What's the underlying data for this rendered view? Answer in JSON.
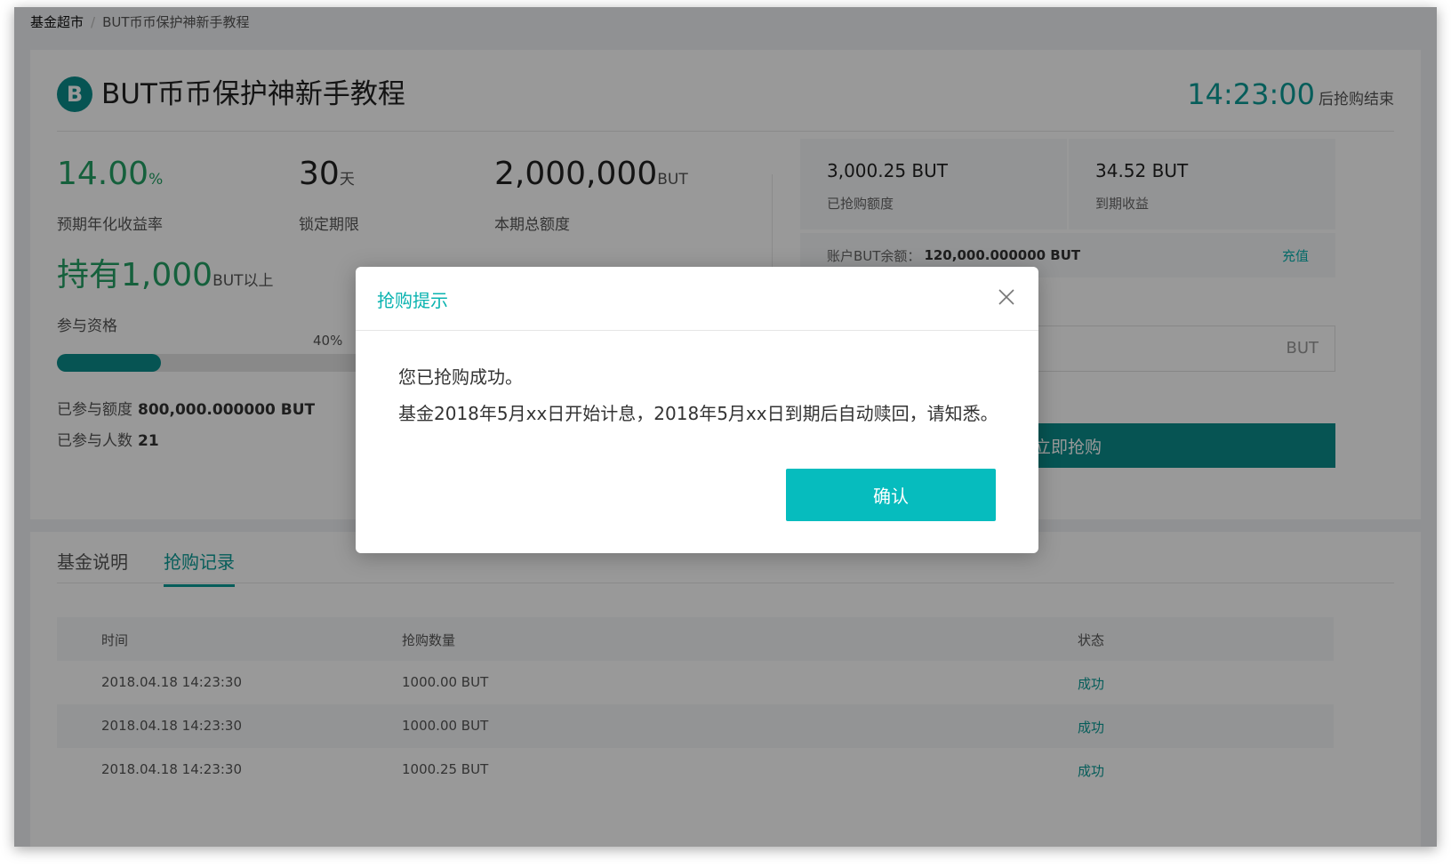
{
  "breadcrumb": {
    "root": "基金超市",
    "separator": "/",
    "current": "BUT币币保护神新手教程"
  },
  "fund": {
    "icon": "bitcoin-b-icon",
    "logo_glyph": "B",
    "title": "BUT币币保护神新手教程",
    "countdown_time": "14:23:00",
    "countdown_suffix": "后抢购结束"
  },
  "stats": {
    "rate_value": "14.00",
    "rate_unit": "%",
    "rate_label": "预期年化收益率",
    "lock_value": "30",
    "lock_unit": "天",
    "lock_label": "锁定期限",
    "total_value": "2,000,000",
    "total_unit": "BUT",
    "total_label": "本期总额度",
    "hold_value": "持有1,000",
    "hold_unit": "BUT以上",
    "hold_label": "参与资格"
  },
  "progress": {
    "percent_text": "40%",
    "value": 0.4
  },
  "participation": {
    "amount_label": "已参与额度",
    "amount_value": "800,000.000000 BUT",
    "count_label": "已参与人数",
    "count_value": "21"
  },
  "purchase": {
    "bought_value": "3,000.25 BUT",
    "bought_label": "已抢购额度",
    "income_value": "34.52 BUT",
    "income_label": "到期收益",
    "balance_label": "账户BUT余额：",
    "balance_value": "120,000.000000 BUT",
    "recharge_label": "充值",
    "input_unit": "BUT",
    "buy_button": "立即抢购"
  },
  "tabs": [
    {
      "label": "基金说明",
      "active": false
    },
    {
      "label": "抢购记录",
      "active": true
    }
  ],
  "table": {
    "headers": [
      "时间",
      "抢购数量",
      "状态"
    ],
    "rows": [
      [
        "2018.04.18 14:23:30",
        "1000.00 BUT",
        "成功"
      ],
      [
        "2018.04.18 14:23:30",
        "1000.00 BUT",
        "成功"
      ],
      [
        "2018.04.18 14:23:30",
        "1000.25 BUT",
        "成功"
      ]
    ]
  },
  "modal": {
    "title": "抢购提示",
    "close_icon": "close-icon",
    "line1": "您已抢购成功。",
    "line2": "基金2018年5月xx日开始计息，2018年5月xx日到期后自动赎回，请知悉。",
    "confirm_label": "确认"
  },
  "colors": {
    "brand_teal": "#0a8c8a",
    "accent_cyan": "#06bcbe",
    "green": "#23a064",
    "overlay": "rgba(0,0,0,0.40)"
  }
}
